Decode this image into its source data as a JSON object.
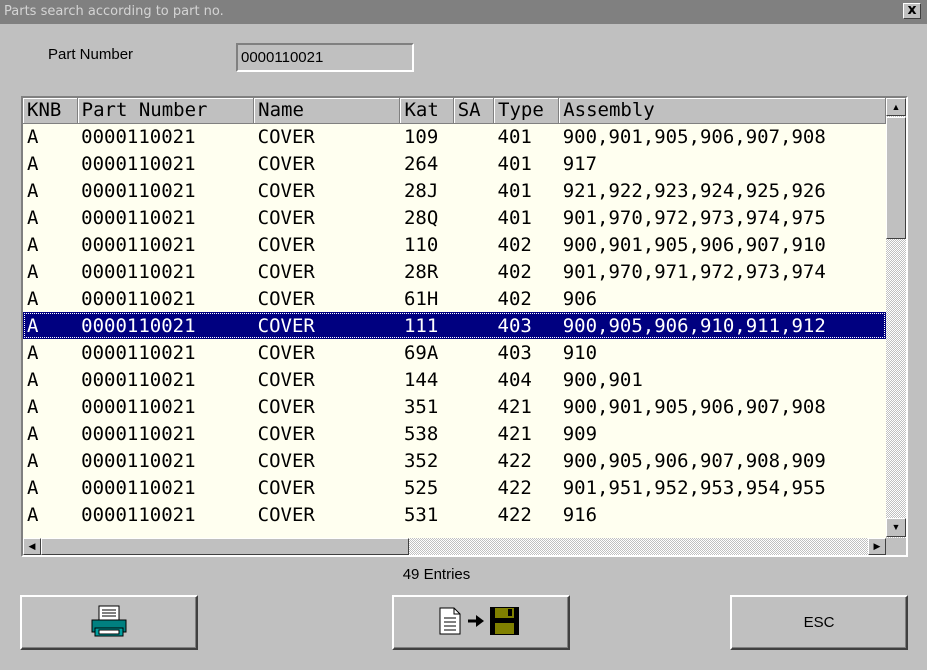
{
  "window": {
    "title": "Parts search according to part no.",
    "close_label": "x"
  },
  "search": {
    "label": "Part Number",
    "value": "0000110021"
  },
  "table": {
    "columns": [
      "KNB",
      "Part Number",
      "Name",
      "Kat",
      "SA",
      "Type",
      "Assembly"
    ],
    "selected_row_index": 7,
    "rows": [
      [
        "A",
        "0000110021",
        "COVER",
        "109",
        "",
        "401",
        "900,901,905,906,907,908"
      ],
      [
        "A",
        "0000110021",
        "COVER",
        "264",
        "",
        "401",
        "917"
      ],
      [
        "A",
        "0000110021",
        "COVER",
        "28J",
        "",
        "401",
        "921,922,923,924,925,926"
      ],
      [
        "A",
        "0000110021",
        "COVER",
        "28Q",
        "",
        "401",
        "901,970,972,973,974,975"
      ],
      [
        "A",
        "0000110021",
        "COVER",
        "110",
        "",
        "402",
        "900,901,905,906,907,910"
      ],
      [
        "A",
        "0000110021",
        "COVER",
        "28R",
        "",
        "402",
        "901,970,971,972,973,974"
      ],
      [
        "A",
        "0000110021",
        "COVER",
        "61H",
        "",
        "402",
        "906"
      ],
      [
        "A",
        "0000110021",
        "COVER",
        "111",
        "",
        "403",
        "900,905,906,910,911,912"
      ],
      [
        "A",
        "0000110021",
        "COVER",
        "69A",
        "",
        "403",
        "910"
      ],
      [
        "A",
        "0000110021",
        "COVER",
        "144",
        "",
        "404",
        "900,901"
      ],
      [
        "A",
        "0000110021",
        "COVER",
        "351",
        "",
        "421",
        "900,901,905,906,907,908"
      ],
      [
        "A",
        "0000110021",
        "COVER",
        "538",
        "",
        "421",
        "909"
      ],
      [
        "A",
        "0000110021",
        "COVER",
        "352",
        "",
        "422",
        "900,905,906,907,908,909"
      ],
      [
        "A",
        "0000110021",
        "COVER",
        "525",
        "",
        "422",
        "901,951,952,953,954,955"
      ],
      [
        "A",
        "0000110021",
        "COVER",
        "531",
        "",
        "422",
        "916"
      ]
    ]
  },
  "status": {
    "entries": "49 Entries"
  },
  "buttons": {
    "print_icon": "printer-icon",
    "export_icon": "document-to-floppy-icon",
    "esc_label": "ESC"
  },
  "colors": {
    "background": "#c0c0c0",
    "titlebar": "#808080",
    "grid_background": "#fffff0",
    "selection": "#000080",
    "printer_accent": "#008080"
  }
}
